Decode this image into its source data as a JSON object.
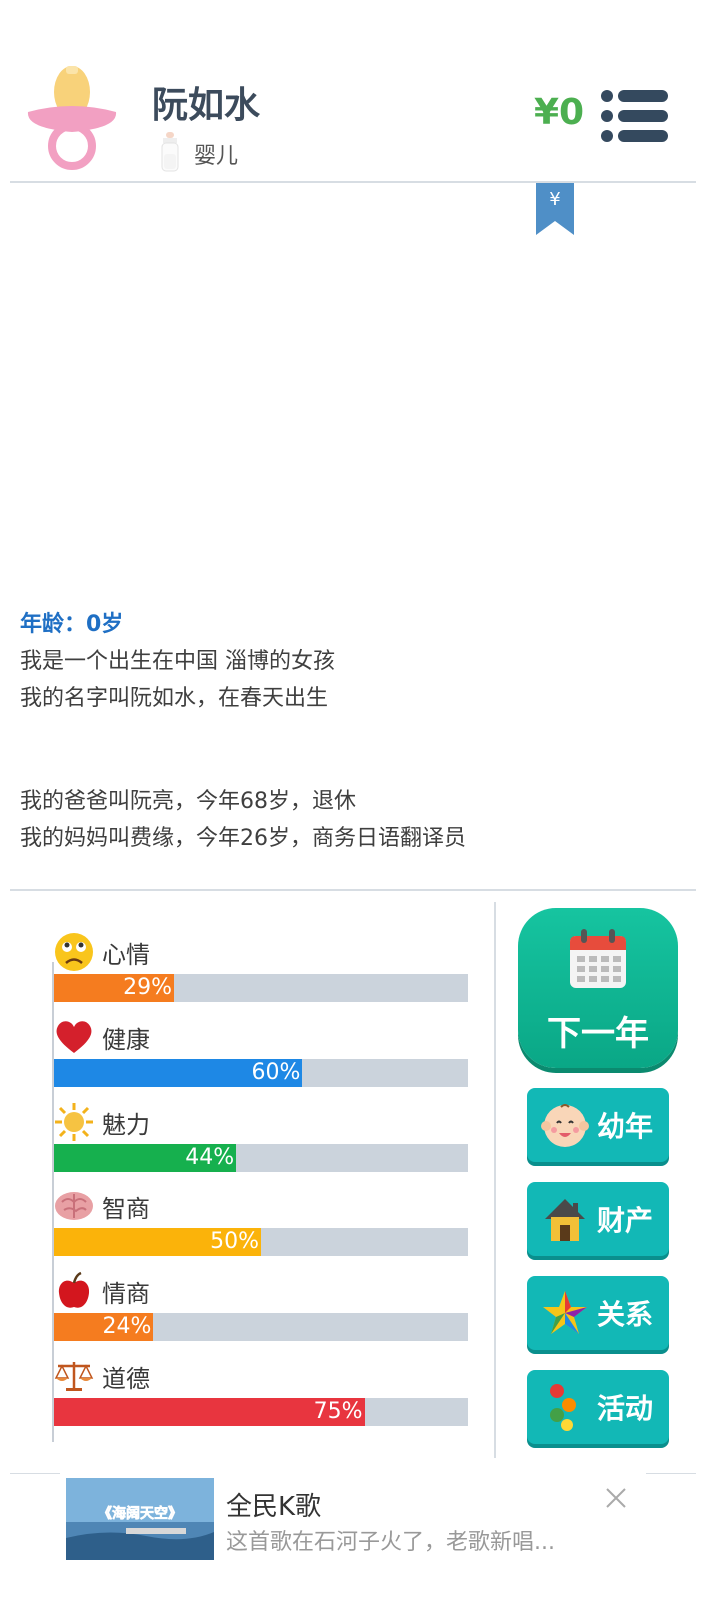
{
  "header": {
    "name": "阮如水",
    "stage": "婴儿",
    "money": "¥0",
    "bookmark_symbol": "¥"
  },
  "story": {
    "age_line": "年龄：0岁",
    "lines": [
      "我是一个出生在中国 淄博的女孩",
      "我的名字叫阮如水，在春天出生"
    ],
    "parents": [
      "我的爸爸叫阮亮，今年68岁，退休",
      "我的妈妈叫费缘，今年26岁，商务日语翻译员"
    ]
  },
  "stats": [
    {
      "label": "心情",
      "value": 29,
      "pct_text": "29%",
      "color": "#f57c1f",
      "icon": "sad-face-icon"
    },
    {
      "label": "健康",
      "value": 60,
      "pct_text": "60%",
      "color": "#1e88e5",
      "icon": "heart-icon"
    },
    {
      "label": "魅力",
      "value": 44,
      "pct_text": "44%",
      "color": "#16b04e",
      "icon": "sun-icon"
    },
    {
      "label": "智商",
      "value": 50,
      "pct_text": "50%",
      "color": "#fbb30a",
      "icon": "brain-icon"
    },
    {
      "label": "情商",
      "value": 24,
      "pct_text": "24%",
      "color": "#f57c1f",
      "icon": "apple-icon"
    },
    {
      "label": "道德",
      "value": 75,
      "pct_text": "75%",
      "color": "#e8353f",
      "icon": "scales-icon"
    }
  ],
  "actions": {
    "next_year": "下一年",
    "childhood": "幼年",
    "assets": "财产",
    "relations": "关系",
    "activities": "活动"
  },
  "ad": {
    "title": "全民K歌",
    "desc": "这首歌在石河子火了，老歌新唱...",
    "thumb_text": "《海阔天空》"
  }
}
